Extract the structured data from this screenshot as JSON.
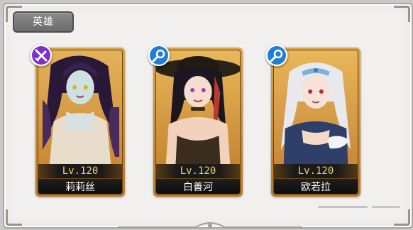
{
  "panel": {
    "title": "英雄"
  },
  "heroes": [
    {
      "name": "莉莉丝",
      "level": "Lv.120",
      "badge_icon": "melee-class-icon",
      "badge_color": "#7a33c8"
    },
    {
      "name": "白善河",
      "level": "Lv.120",
      "badge_icon": "magnifier-class-icon",
      "badge_color": "#1f7fd6"
    },
    {
      "name": "欧若拉",
      "level": "Lv.120",
      "badge_icon": "magnifier-class-icon",
      "badge_color": "#1f7fd6"
    }
  ],
  "colors": {
    "card_frame": "#d9a44a",
    "level_text": "#f2cf6b",
    "name_text": "#ffffff"
  }
}
